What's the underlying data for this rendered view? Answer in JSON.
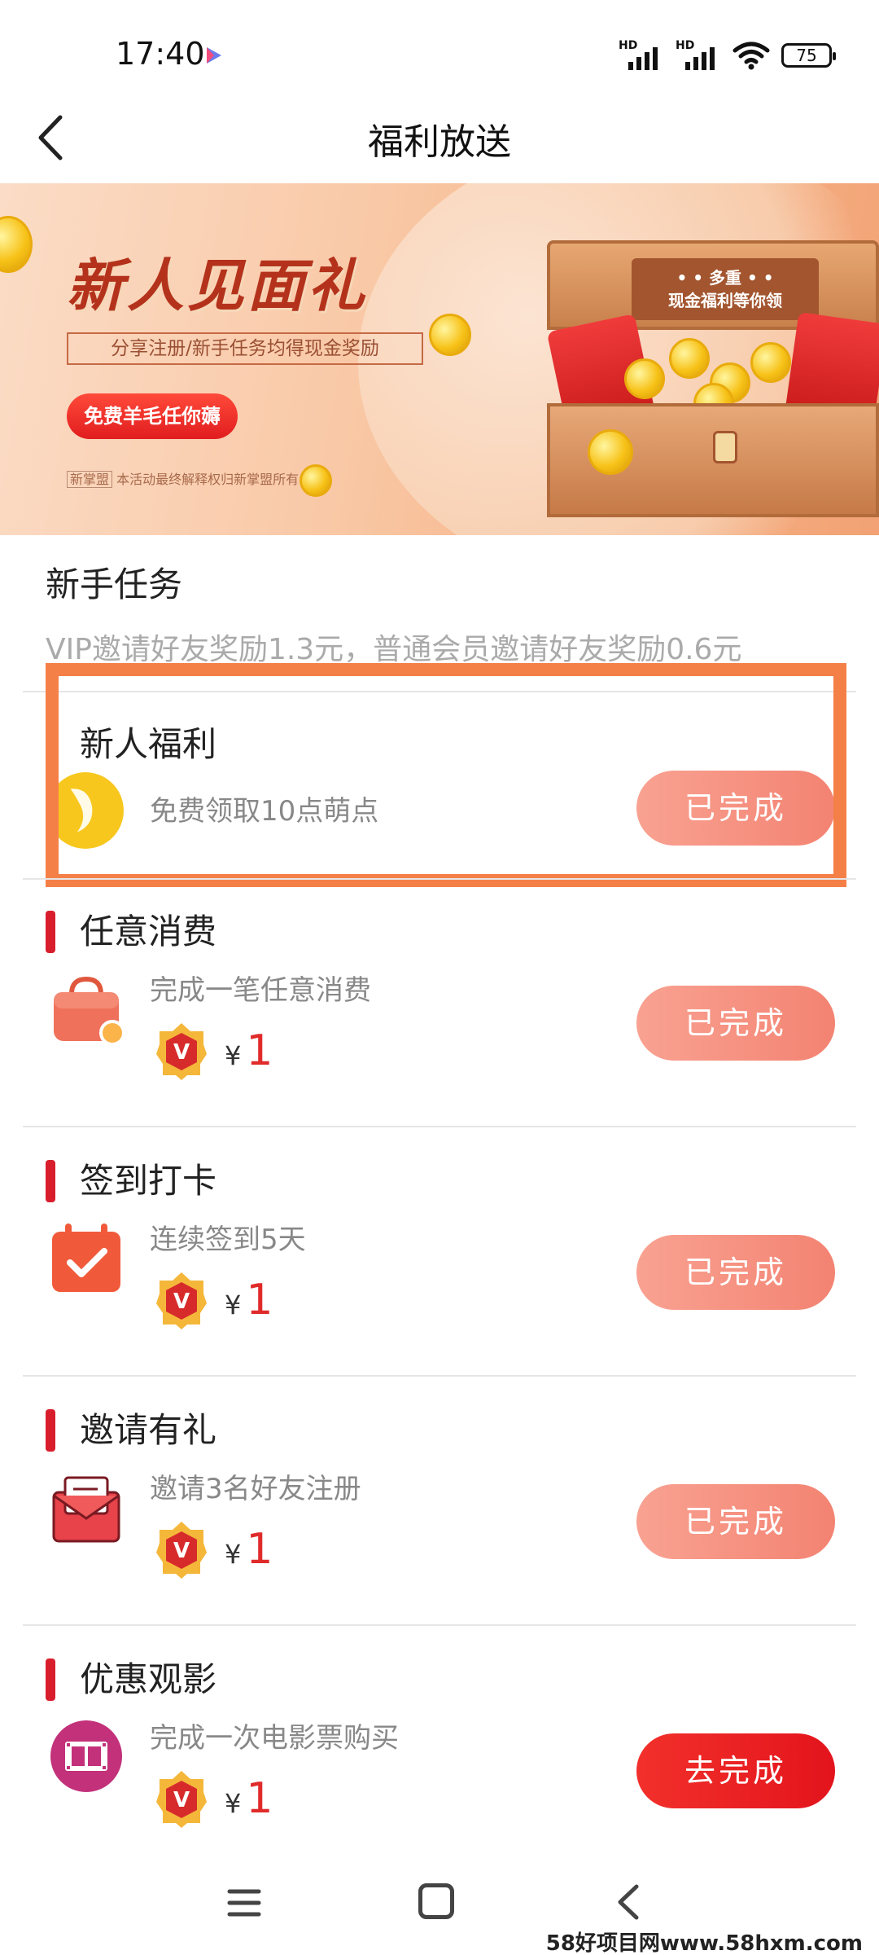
{
  "status_bar": {
    "time": "17:40",
    "signal_1_label": "HD",
    "signal_2_label": "HD",
    "battery": "75"
  },
  "header": {
    "title": "福利放送"
  },
  "banner": {
    "title": "新人见面礼",
    "subtitle": "分享注册/新手任务均得现金奖励",
    "button": "免费羊毛任你薅",
    "footnote_logo": "新掌盟",
    "footnote": "本活动最终解释权归新掌盟所有",
    "chest_sign_line1": "• • 多重 • •",
    "chest_sign_line2": "现金福利等你领"
  },
  "section": {
    "title": "新手任务",
    "desc": "VIP邀请好友奖励1.3元，普通会员邀请好友奖励0.6元"
  },
  "tasks": [
    {
      "name": "新人福利",
      "desc": "免费领取10点萌点",
      "button": "已完成",
      "icon": "moon-coin-icon"
    },
    {
      "name": "任意消费",
      "desc": "完成一笔任意消费",
      "yen": "¥",
      "amount": "1",
      "button": "已完成",
      "icon": "shopping-bag-icon"
    },
    {
      "name": "签到打卡",
      "desc": "连续签到5天",
      "yen": "¥",
      "amount": "1",
      "button": "已完成",
      "icon": "calendar-check-icon"
    },
    {
      "name": "邀请有礼",
      "desc": "邀请3名好友注册",
      "yen": "¥",
      "amount": "1",
      "button": "已完成",
      "icon": "invitation-envelope-icon"
    },
    {
      "name": "优惠观影",
      "desc": "完成一次电影票购买",
      "yen": "¥",
      "amount": "1",
      "button": "去完成",
      "icon": "film-icon"
    }
  ],
  "colors": {
    "accent_red": "#e3141c",
    "done_button": "#f38372",
    "highlight_box": "#f58047",
    "marker": "#d81e2c"
  },
  "watermark": "58好项目网www.58hxm.com"
}
